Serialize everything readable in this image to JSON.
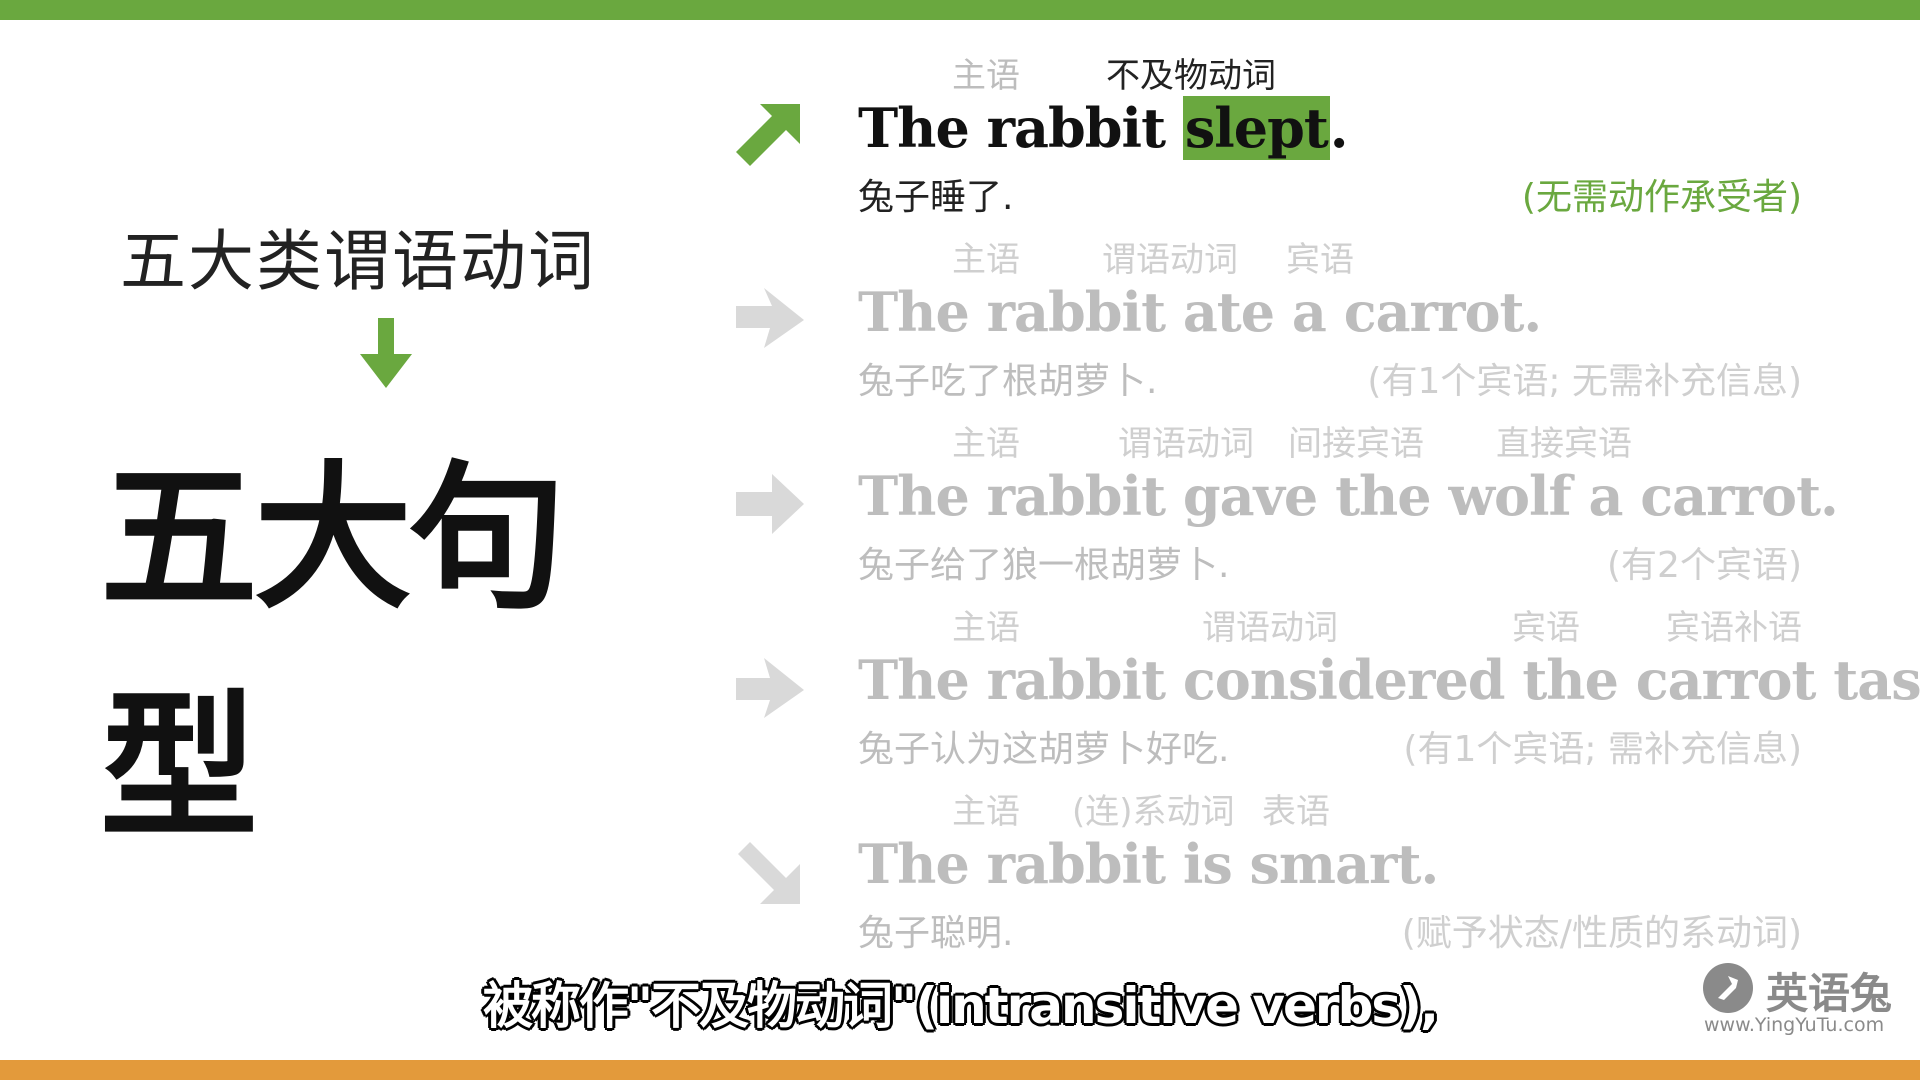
{
  "colors": {
    "accent_green": "#6aa83f",
    "bottom_orange": "#e39a3b",
    "dim_gray": "#bdbdbd"
  },
  "left": {
    "subtitle": "五大类谓语动词",
    "arrow_icon": "down-arrow-icon",
    "title": "五大句型"
  },
  "rows": [
    {
      "labels": [
        "主语",
        "不及物动词"
      ],
      "sentence_pre": "The rabbit ",
      "sentence_hl": "slept",
      "sentence_post": ".",
      "cn": "兔子睡了.",
      "note": "(无需动作承受者)"
    },
    {
      "labels": [
        "主语",
        "谓语动词",
        "宾语"
      ],
      "sentence": "The rabbit ate a carrot.",
      "cn": "兔子吃了根胡萝卜.",
      "note": "(有1个宾语; 无需补充信息)"
    },
    {
      "labels": [
        "主语",
        "谓语动词",
        "间接宾语",
        "直接宾语"
      ],
      "sentence": "The rabbit gave the wolf a carrot.",
      "cn": "兔子给了狼一根胡萝卜.",
      "note": "(有2个宾语)"
    },
    {
      "labels": [
        "主语",
        "谓语动词",
        "宾语",
        "宾语补语"
      ],
      "sentence": "The rabbit considered the carrot tasty.",
      "cn": "兔子认为这胡萝卜好吃.",
      "note": "(有1个宾语; 需补充信息)"
    },
    {
      "labels": [
        "主语",
        "(连)系动词",
        "表语"
      ],
      "sentence": "The rabbit is smart.",
      "cn": "兔子聪明.",
      "note": "(赋予状态/性质的系动词)"
    }
  ],
  "caption": "被称作\"不及物动词\"(intransitive verbs),",
  "logo": {
    "icon": "rabbit-logo-icon",
    "text": "英语兔",
    "url": "www.YingYuTu.com"
  }
}
